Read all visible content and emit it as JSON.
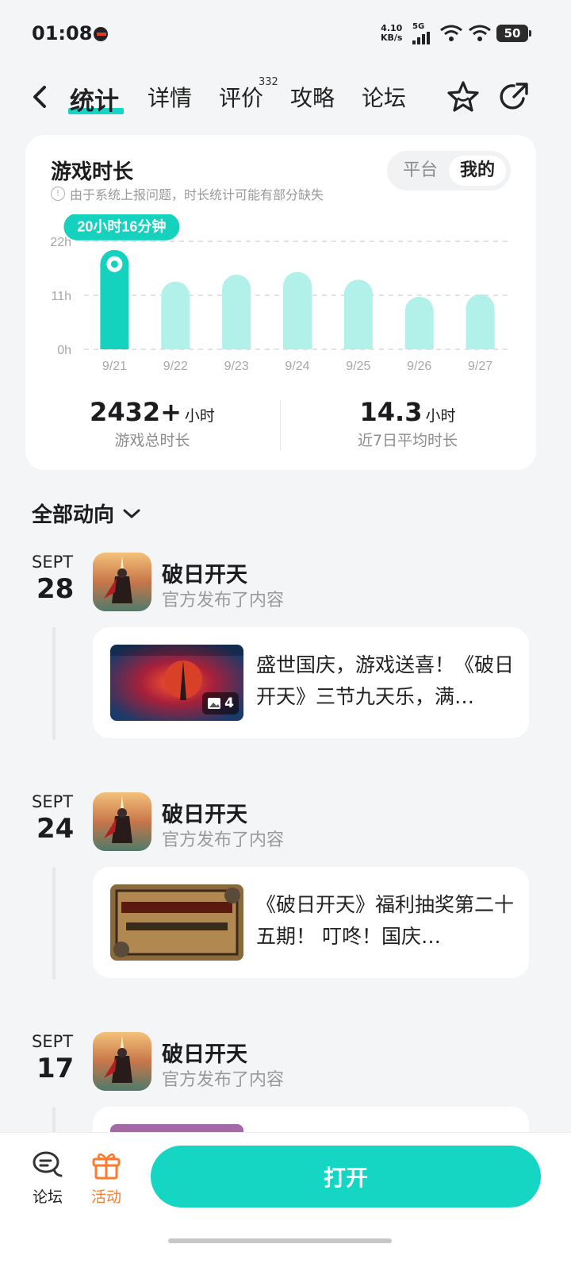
{
  "status_bar": {
    "time": "01:08",
    "speed_value": "4.10",
    "speed_unit": "KB/s",
    "network": "5G",
    "battery": "50"
  },
  "nav": {
    "tabs": [
      {
        "label": "统计",
        "active": true
      },
      {
        "label": "详情"
      },
      {
        "label": "评价",
        "count": "332"
      },
      {
        "label": "攻略"
      },
      {
        "label": "论坛"
      }
    ],
    "icons": [
      "back-icon",
      "star-icon",
      "share-icon"
    ]
  },
  "stats": {
    "title": "游戏时长",
    "note": "由于系统上报问题，时长统计可能有部分缺失",
    "toggle": [
      "平台",
      "我的"
    ],
    "toggle_selected": "我的",
    "tooltip": "20小时16分钟",
    "total_value": "2432+",
    "total_unit": "小时",
    "total_label": "游戏总时长",
    "avg_value": "14.3",
    "avg_unit": "小时",
    "avg_label": "近7日平均时长"
  },
  "chart_data": {
    "type": "bar",
    "categories": [
      "9/21",
      "9/22",
      "9/23",
      "9/24",
      "9/25",
      "9/26",
      "9/27"
    ],
    "values": [
      20.27,
      13.8,
      15.2,
      15.8,
      14.2,
      10.7,
      11.2
    ],
    "yticks": [
      "22h",
      "11h",
      "0h"
    ],
    "ylim": [
      0,
      22
    ],
    "highlight_index": 0,
    "colors": {
      "highlight": "#15d2bf",
      "normal": "#b2f0ea",
      "grid": "#e2e2e2"
    }
  },
  "feed": {
    "filter_label": "全部动向",
    "items": [
      {
        "month": "SEPT",
        "day": "28",
        "game": "破日开天",
        "action": "官方发布了内容",
        "text": "盛世国庆，游戏送喜！《破日开天》三节九天乐，满…",
        "image_count": "4"
      },
      {
        "month": "SEPT",
        "day": "24",
        "game": "破日开天",
        "action": "官方发布了内容",
        "text": "《破日开天》福利抽奖第二十五期！ 叮咚！国庆…"
      },
      {
        "month": "SEPT",
        "day": "17",
        "game": "破日开天",
        "action": "官方发布了内容",
        "text": ""
      }
    ]
  },
  "bottom": {
    "forum_label": "论坛",
    "activity_label": "活动",
    "open_label": "打开",
    "accent": "#ff7a2e"
  }
}
